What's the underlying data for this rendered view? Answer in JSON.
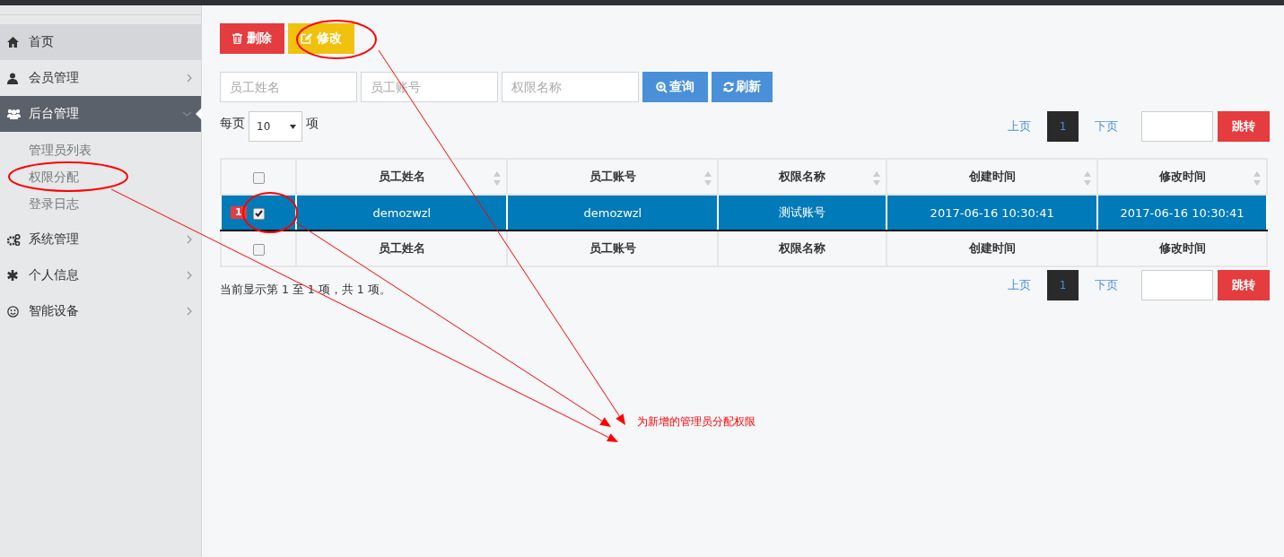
{
  "sidebar": {
    "items": [
      {
        "label": "首页",
        "kind": "home",
        "selected": true
      },
      {
        "label": "会员管理",
        "kind": "user",
        "selected": false,
        "expanded": false
      },
      {
        "label": "后台管理",
        "kind": "users",
        "selected": false,
        "expanded": true,
        "children": [
          {
            "label": "管理员列表",
            "selected": false
          },
          {
            "label": "权限分配",
            "selected": false
          },
          {
            "label": "登录日志",
            "selected": false
          }
        ]
      },
      {
        "label": "系统管理",
        "kind": "cogs",
        "selected": false,
        "expanded": false
      },
      {
        "label": "个人信息",
        "kind": "asterisk",
        "selected": false,
        "expanded": false
      },
      {
        "label": "智能设备",
        "kind": "smile",
        "selected": false,
        "expanded": false
      }
    ]
  },
  "toolbar": [
    {
      "label": "删除",
      "kind": "delete"
    },
    {
      "label": "修改",
      "kind": "edit"
    }
  ],
  "filters": [
    {
      "placeholder": "员工姓名"
    },
    {
      "placeholder": "员工账号"
    },
    {
      "placeholder": "权限名称"
    }
  ],
  "search_buttons": [
    {
      "label": "查询",
      "kind": "search"
    },
    {
      "label": "刷新",
      "kind": "refresh"
    }
  ],
  "page_size": {
    "label_before": "每页",
    "value": "10",
    "label_after": "项"
  },
  "pager_top": {
    "prev": "上页",
    "current": "1",
    "next": "下页",
    "jump": "跳转"
  },
  "table": {
    "header_checked": false,
    "columns": [
      {
        "label": "员工姓名",
        "sortable": true
      },
      {
        "label": "员工账号",
        "sortable": true
      },
      {
        "label": "权限名称",
        "sortable": true
      },
      {
        "label": "创建时间",
        "sortable": true
      },
      {
        "label": "修改时间",
        "sortable": true
      }
    ],
    "rows": [
      {
        "number": "1",
        "checked": true,
        "selected": true,
        "cells": [
          "demozwzl",
          "demozwzl",
          "测试账号",
          "2017-06-16 10:30:41",
          "2017-06-16 10:30:41"
        ]
      }
    ],
    "footer_checked": false,
    "footer_columns": [
      "员工姓名",
      "员工账号",
      "权限名称",
      "创建时间",
      "修改时间"
    ]
  },
  "info": "当前显示第 1 至 1 项，共 1 项。",
  "pager_bottom": {
    "prev": "上页",
    "current": "1",
    "next": "下页",
    "jump": "跳转"
  },
  "annotation": {
    "text": "为新增的管理员分配权限"
  }
}
